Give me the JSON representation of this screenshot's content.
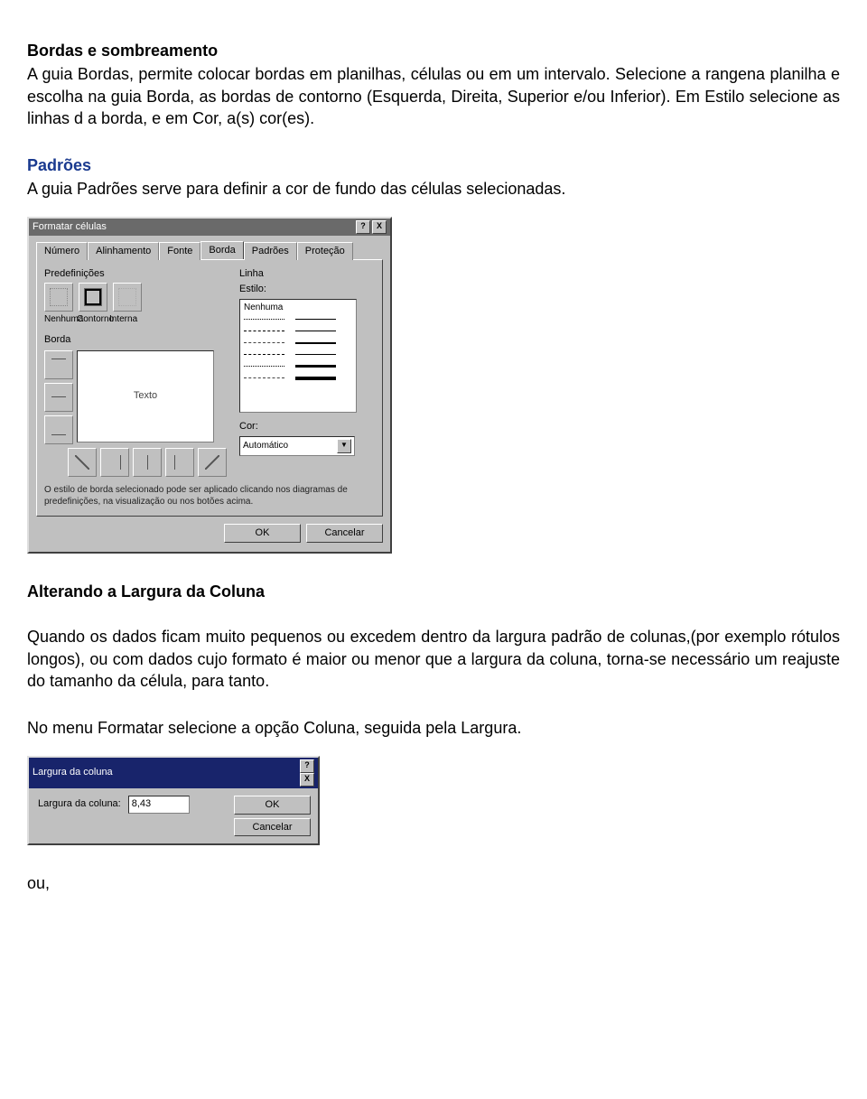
{
  "section1": {
    "heading": "Bordas e sombreamento",
    "para": "A guia Bordas, permite colocar bordas em planilhas, células ou em um intervalo. Selecione a rangena planilha e escolha na guia Borda, as bordas de contorno (Esquerda, Direita, Superior e/ou Inferior). Em Estilo selecione as linhas d a borda, e em Cor, a(s) cor(es)."
  },
  "section2": {
    "heading": "Padrões",
    "para": "A guia Padrões serve para definir a cor de fundo das células selecionadas."
  },
  "dialog1": {
    "title": "Formatar células",
    "help_btn": "?",
    "close_btn": "X",
    "tabs": [
      "Número",
      "Alinhamento",
      "Fonte",
      "Borda",
      "Padrões",
      "Proteção"
    ],
    "presets_label": "Predefinições",
    "preset_none": "Nenhuma",
    "preset_outline": "Contorno",
    "preset_inside": "Interna",
    "border_label": "Borda",
    "preview_text": "Texto",
    "line_label": "Linha",
    "style_label": "Estilo:",
    "style_none": "Nenhuma",
    "color_label": "Cor:",
    "color_value": "Automático",
    "hint": "O estilo de borda selecionado pode ser aplicado clicando nos diagramas de predefinições, na visualização ou nos botões acima.",
    "ok": "OK",
    "cancel": "Cancelar"
  },
  "section3": {
    "heading": "Alterando a Largura da Coluna",
    "para1": "Quando os dados ficam muito pequenos ou excedem dentro da largura padrão de colunas,(por exemplo rótulos longos), ou com dados cujo formato é maior ou menor que a largura da coluna, torna-se necessário um reajuste do tamanho da célula, para tanto.",
    "para2": "No menu Formatar selecione a opção Coluna, seguida pela Largura."
  },
  "dialog2": {
    "title": "Largura da coluna",
    "help_btn": "?",
    "close_btn": "X",
    "label": "Largura da coluna:",
    "value": "8,43",
    "ok": "OK",
    "cancel": "Cancelar"
  },
  "footer": {
    "ou": "ou,"
  }
}
